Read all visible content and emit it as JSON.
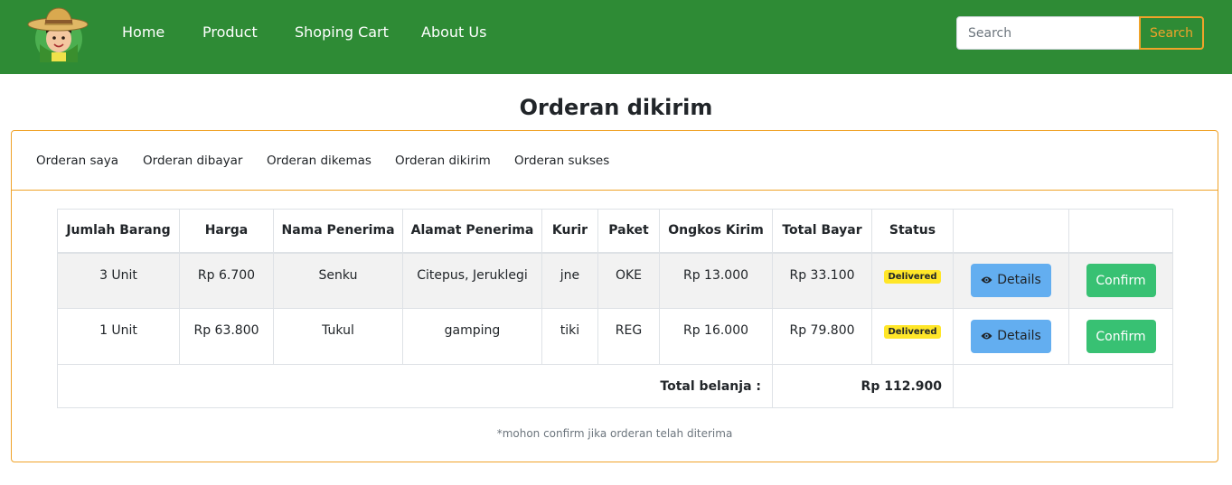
{
  "navbar": {
    "links": [
      "Home",
      "Product",
      "Shoping Cart",
      "About Us"
    ],
    "search_placeholder": "Search",
    "search_button": "Search"
  },
  "page": {
    "title": "Orderan dikirim"
  },
  "tabs": [
    "Orderan saya",
    "Orderan dibayar",
    "Orderan dikemas",
    "Orderan dikirim",
    "Orderan sukses"
  ],
  "table": {
    "headers": [
      "Jumlah Barang",
      "Harga",
      "Nama Penerima",
      "Alamat Penerima",
      "Kurir",
      "Paket",
      "Ongkos Kirim",
      "Total Bayar",
      "Status"
    ],
    "rows": [
      {
        "qty": "3 Unit",
        "price": "Rp 6.700",
        "name": "Senku",
        "address": "Citepus, Jeruklegi",
        "courier": "jne",
        "package": "OKE",
        "shipping": "Rp 13.000",
        "total": "Rp 33.100",
        "status": "Delivered"
      },
      {
        "qty": "1 Unit",
        "price": "Rp 63.800",
        "name": "Tukul",
        "address": "gamping",
        "courier": "tiki",
        "package": "REG",
        "shipping": "Rp 16.000",
        "total": "Rp 79.800",
        "status": "Delivered"
      }
    ],
    "details_label": "Details",
    "confirm_label": "Confirm",
    "total_label": "Total belanja :",
    "total_value": "Rp 112.900"
  },
  "note": "*mohon confirm jika orderan telah diterima",
  "colors": {
    "navbar": "#2e8b35",
    "accent": "#f0a32a",
    "details": "#63aef0",
    "confirm": "#38c173",
    "badge": "#ffe628"
  }
}
